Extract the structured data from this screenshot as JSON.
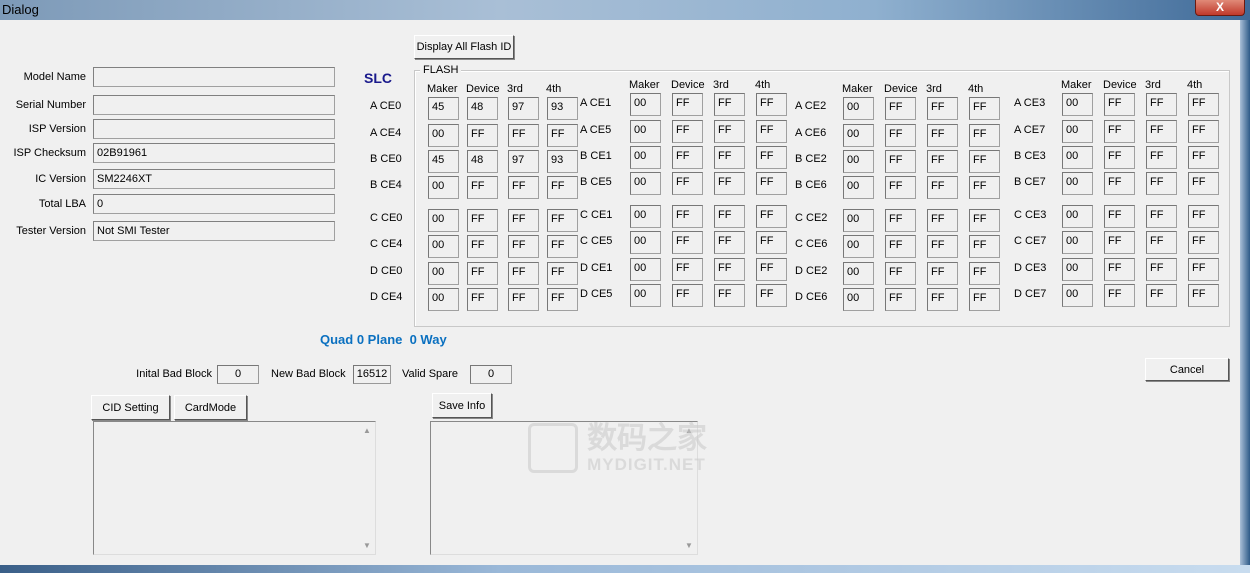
{
  "window": {
    "title": "Dialog",
    "close_label": "X"
  },
  "info_fields": [
    {
      "label": "Model Name",
      "value": ""
    },
    {
      "label": "Serial Number",
      "value": ""
    },
    {
      "label": "ISP Version",
      "value": ""
    },
    {
      "label": "ISP Checksum",
      "value": "02B91961"
    },
    {
      "label": "IC Version",
      "value": "SM2246XT"
    },
    {
      "label": "Total LBA",
      "value": "0"
    },
    {
      "label": "Tester Version",
      "value": "Not SMI Tester"
    }
  ],
  "slc_label": "SLC",
  "display_all_button": "Display All Flash ID",
  "flash": {
    "legend": "FLASH",
    "headers": [
      "Maker",
      "Device",
      "3rd",
      "4th"
    ],
    "groups": [
      {
        "rows": [
          {
            "label": "A CE0",
            "values": [
              "45",
              "48",
              "97",
              "93"
            ]
          },
          {
            "label": "A CE4",
            "values": [
              "00",
              "FF",
              "FF",
              "FF"
            ]
          },
          {
            "label": "B CE0",
            "values": [
              "45",
              "48",
              "97",
              "93"
            ]
          },
          {
            "label": "B CE4",
            "values": [
              "00",
              "FF",
              "FF",
              "FF"
            ]
          },
          {
            "label": "C CE0",
            "values": [
              "00",
              "FF",
              "FF",
              "FF"
            ]
          },
          {
            "label": "C CE4",
            "values": [
              "00",
              "FF",
              "FF",
              "FF"
            ]
          },
          {
            "label": "D CE0",
            "values": [
              "00",
              "FF",
              "FF",
              "FF"
            ]
          },
          {
            "label": "D CE4",
            "values": [
              "00",
              "FF",
              "FF",
              "FF"
            ]
          }
        ]
      },
      {
        "rows": [
          {
            "label": "A CE1",
            "values": [
              "00",
              "FF",
              "FF",
              "FF"
            ]
          },
          {
            "label": "A CE5",
            "values": [
              "00",
              "FF",
              "FF",
              "FF"
            ]
          },
          {
            "label": "B CE1",
            "values": [
              "00",
              "FF",
              "FF",
              "FF"
            ]
          },
          {
            "label": "B CE5",
            "values": [
              "00",
              "FF",
              "FF",
              "FF"
            ]
          },
          {
            "label": "C CE1",
            "values": [
              "00",
              "FF",
              "FF",
              "FF"
            ]
          },
          {
            "label": "C CE5",
            "values": [
              "00",
              "FF",
              "FF",
              "FF"
            ]
          },
          {
            "label": "D CE1",
            "values": [
              "00",
              "FF",
              "FF",
              "FF"
            ]
          },
          {
            "label": "D CE5",
            "values": [
              "00",
              "FF",
              "FF",
              "FF"
            ]
          }
        ]
      },
      {
        "rows": [
          {
            "label": "A CE2",
            "values": [
              "00",
              "FF",
              "FF",
              "FF"
            ]
          },
          {
            "label": "A CE6",
            "values": [
              "00",
              "FF",
              "FF",
              "FF"
            ]
          },
          {
            "label": "B CE2",
            "values": [
              "00",
              "FF",
              "FF",
              "FF"
            ]
          },
          {
            "label": "B CE6",
            "values": [
              "00",
              "FF",
              "FF",
              "FF"
            ]
          },
          {
            "label": "C CE2",
            "values": [
              "00",
              "FF",
              "FF",
              "FF"
            ]
          },
          {
            "label": "C CE6",
            "values": [
              "00",
              "FF",
              "FF",
              "FF"
            ]
          },
          {
            "label": "D CE2",
            "values": [
              "00",
              "FF",
              "FF",
              "FF"
            ]
          },
          {
            "label": "D CE6",
            "values": [
              "00",
              "FF",
              "FF",
              "FF"
            ]
          }
        ]
      },
      {
        "rows": [
          {
            "label": "A CE3",
            "values": [
              "00",
              "FF",
              "FF",
              "FF"
            ]
          },
          {
            "label": "A CE7",
            "values": [
              "00",
              "FF",
              "FF",
              "FF"
            ]
          },
          {
            "label": "B CE3",
            "values": [
              "00",
              "FF",
              "FF",
              "FF"
            ]
          },
          {
            "label": "B CE7",
            "values": [
              "00",
              "FF",
              "FF",
              "FF"
            ]
          },
          {
            "label": "C CE3",
            "values": [
              "00",
              "FF",
              "FF",
              "FF"
            ]
          },
          {
            "label": "C CE7",
            "values": [
              "00",
              "FF",
              "FF",
              "FF"
            ]
          },
          {
            "label": "D CE3",
            "values": [
              "00",
              "FF",
              "FF",
              "FF"
            ]
          },
          {
            "label": "D CE7",
            "values": [
              "00",
              "FF",
              "FF",
              "FF"
            ]
          }
        ]
      }
    ]
  },
  "config_text": "Quad 0 Plane  0 Way",
  "bad_blocks": {
    "initial_label": "Inital Bad Block",
    "initial_value": "0",
    "new_label": "New Bad Block",
    "new_value": "16512",
    "spare_label": "Valid Spare",
    "spare_value": "0"
  },
  "buttons": {
    "cid_setting": "CID Setting",
    "card_mode": "CardMode",
    "save_info": "Save Info",
    "cancel": "Cancel"
  },
  "watermark": {
    "cn": "数码之家",
    "en": "MYDIGIT.NET"
  },
  "colors": {
    "slc": "#1a1a8c",
    "config_text": "#0a70c0"
  }
}
